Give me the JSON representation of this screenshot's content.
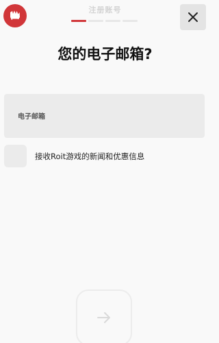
{
  "header": {
    "step_title": "注册账号",
    "progress_steps": [
      true,
      false,
      false,
      false
    ],
    "logo_icon": "riot-fist-icon",
    "close_icon": "close-icon"
  },
  "main": {
    "heading": "您的电子邮箱?",
    "email_field": {
      "label": "电子邮箱",
      "value": ""
    },
    "newsletter": {
      "checked": false,
      "label": "接收Roit游戏的新闻和优惠信息"
    }
  },
  "footer": {
    "next_icon": "arrow-right-icon",
    "next_enabled": false
  },
  "colors": {
    "accent": "#d13639",
    "background": "#f9f9f9",
    "field_bg": "#ebebeb"
  }
}
